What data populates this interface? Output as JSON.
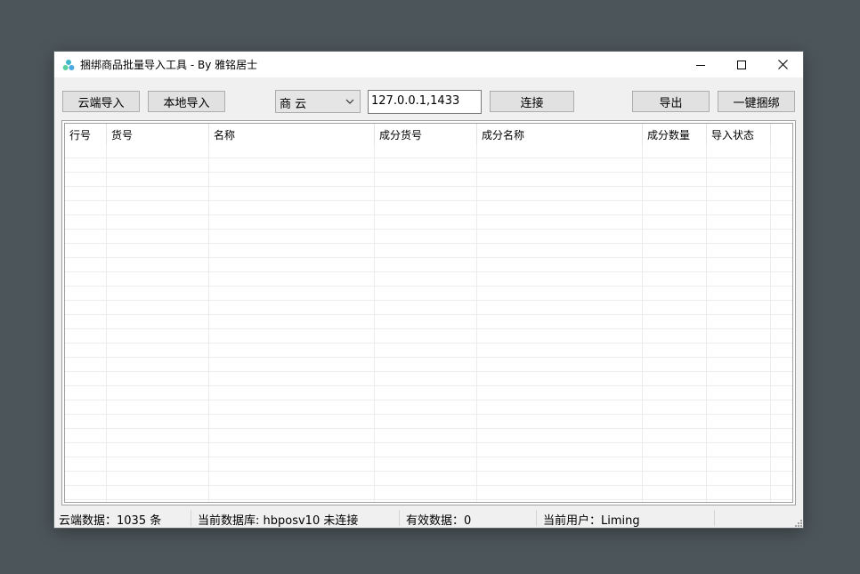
{
  "window": {
    "title": "捆绑商品批量导入工具 - By 雅铭居士",
    "icon": "app-cluster-icon",
    "controls": [
      "minimize-icon",
      "maximize-icon",
      "close-icon"
    ]
  },
  "toolbar": {
    "cloud_import_label": "云端导入",
    "local_import_label": "本地导入",
    "source_select_value": "商 云",
    "server_address_value": "127.0.0.1,1433",
    "connect_label": "连接",
    "export_label": "导出",
    "bind_all_label": "一键捆绑"
  },
  "grid": {
    "columns": [
      "行号",
      "货号",
      "名称",
      "成分货号",
      "成分名称",
      "成分数量",
      "导入状态"
    ],
    "rows": []
  },
  "status": {
    "cloud_count": "云端数据：1035 条",
    "current_db": "当前数据库: hbposv10 未连接",
    "valid_count": "有效数据：0",
    "current_user": "当前用户：Liming"
  },
  "colors": {
    "desktop": "#4c555a",
    "window_bg": "#f0f0f0",
    "button_bg": "#e1e1e1",
    "icon_teal": "#3fb7c9"
  }
}
